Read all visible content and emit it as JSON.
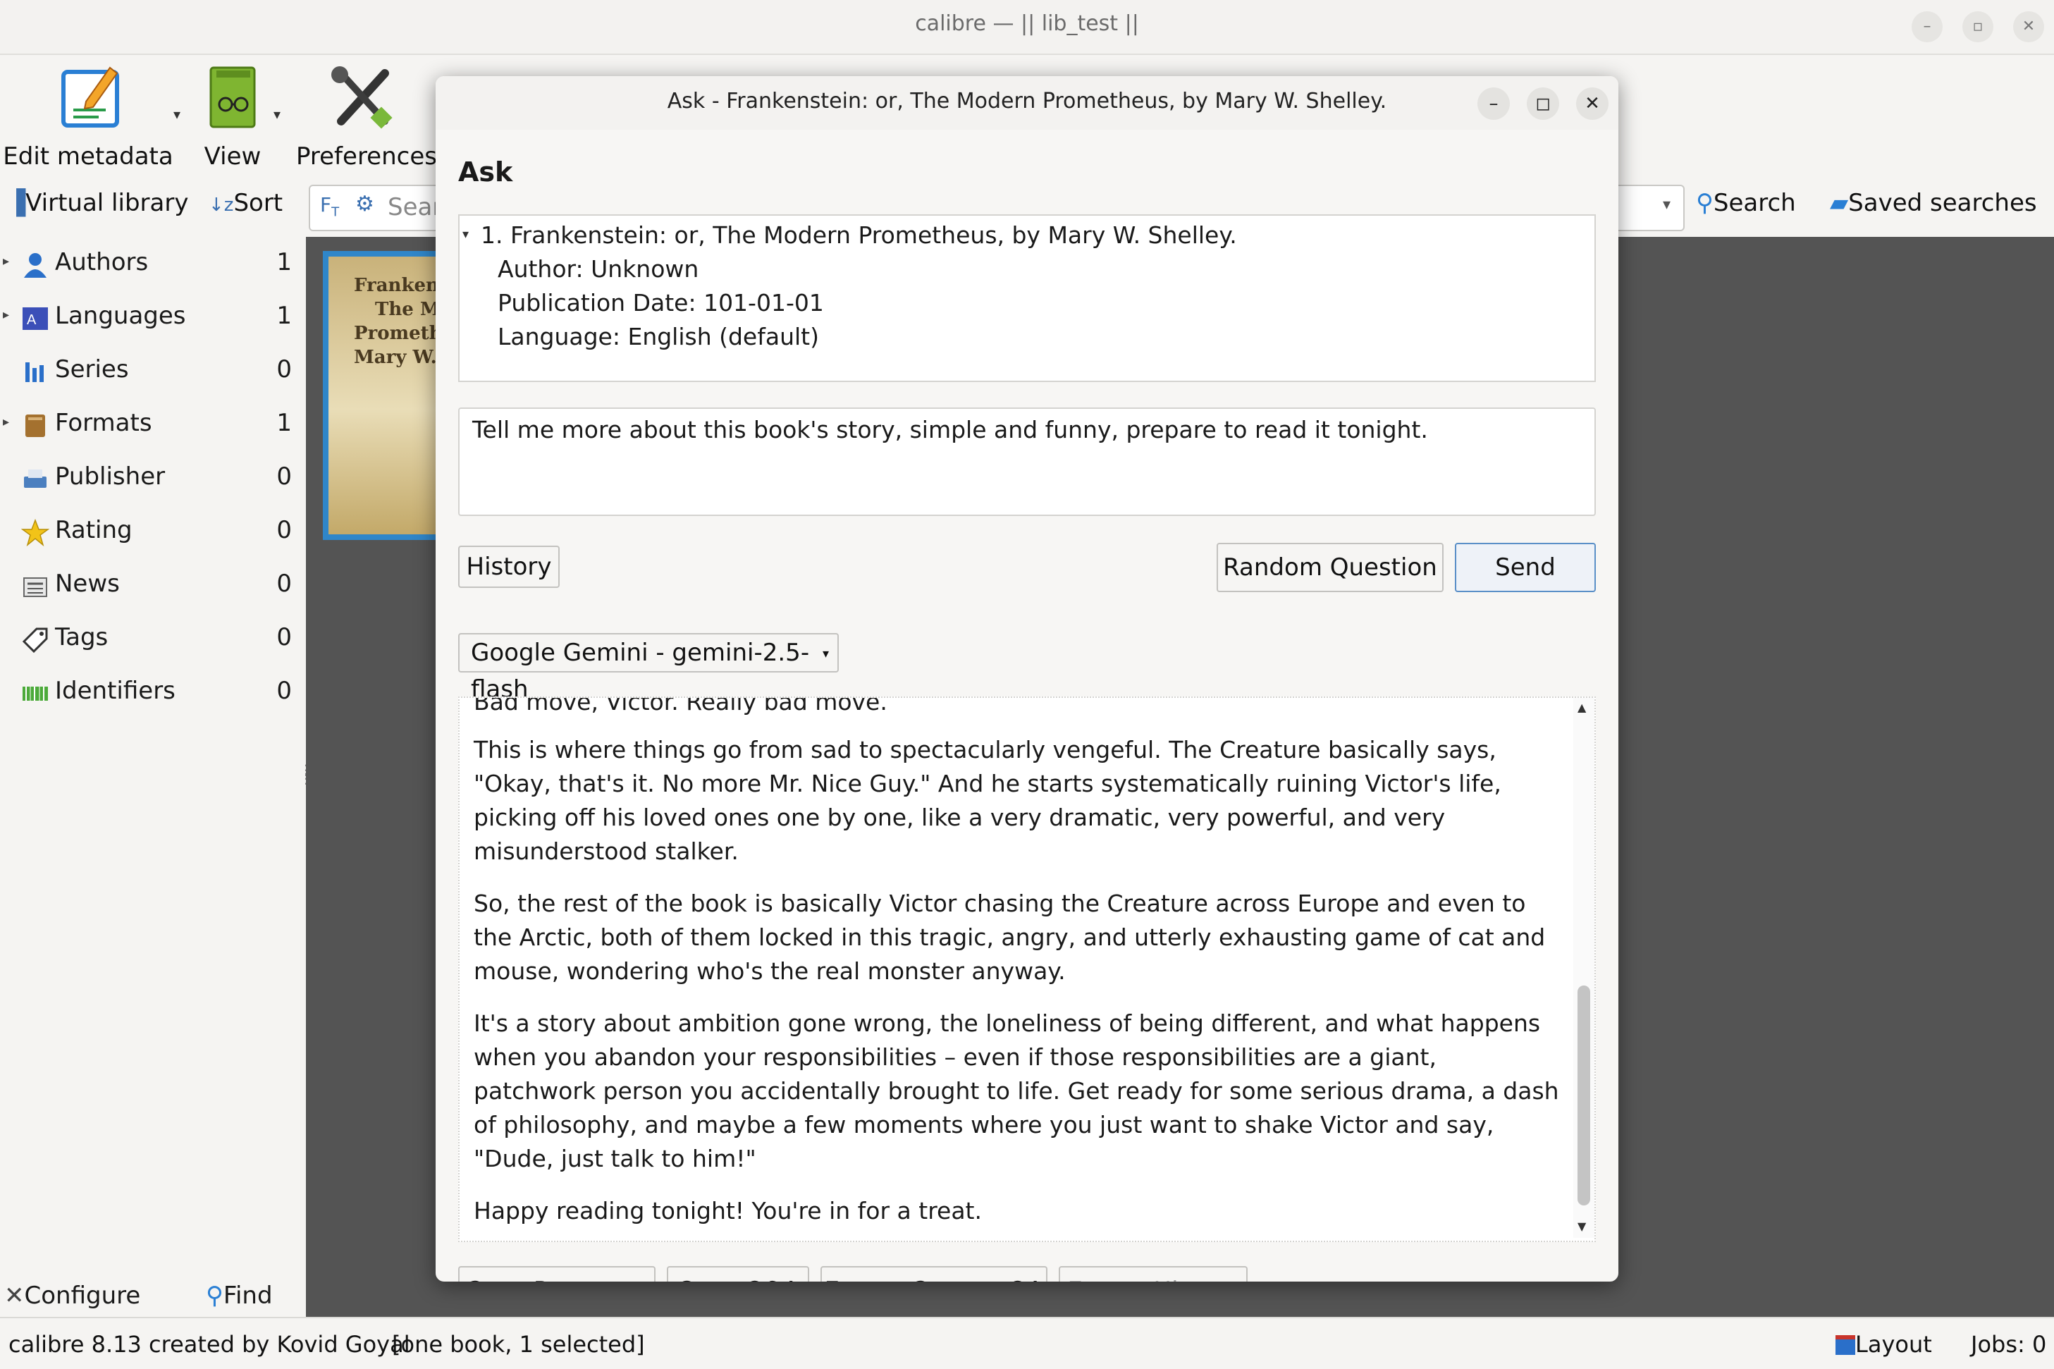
{
  "window": {
    "title": "calibre — || lib_test ||"
  },
  "toolbar": {
    "edit_metadata": "Edit metadata",
    "view": "View",
    "preferences": "Preferences"
  },
  "row2": {
    "virtual_library": "Virtual library",
    "sort": "Sort",
    "search_placeholder": "Sear",
    "search": "Search",
    "saved_searches": "Saved searches"
  },
  "tags": [
    {
      "name": "Authors",
      "count": "1",
      "icon": "person-icon",
      "expandable": true
    },
    {
      "name": "Languages",
      "count": "1",
      "icon": "language-icon",
      "expandable": true
    },
    {
      "name": "Series",
      "count": "0",
      "icon": "series-icon",
      "expandable": false
    },
    {
      "name": "Formats",
      "count": "1",
      "icon": "book-icon",
      "expandable": true
    },
    {
      "name": "Publisher",
      "count": "0",
      "icon": "publisher-icon",
      "expandable": false
    },
    {
      "name": "Rating",
      "count": "0",
      "icon": "star-icon",
      "expandable": false
    },
    {
      "name": "News",
      "count": "0",
      "icon": "news-icon",
      "expandable": false
    },
    {
      "name": "Tags",
      "count": "0",
      "icon": "tag-icon",
      "expandable": false
    },
    {
      "name": "Identifiers",
      "count": "0",
      "icon": "barcode-icon",
      "expandable": false
    }
  ],
  "cover": {
    "lines": [
      "Frankens",
      "The M",
      "Prometh",
      "Mary W."
    ]
  },
  "bottom_left": {
    "configure": "Configure",
    "find": "Find"
  },
  "status": {
    "left": "calibre 8.13 created by Kovid Goyal",
    "selection": "[one book, 1 selected]",
    "layout": "Layout",
    "jobs": "Jobs: 0"
  },
  "dialog": {
    "title": "Ask - Frankenstein: or, The Modern Prometheus, by Mary W. Shelley.",
    "heading": "Ask",
    "book_info": {
      "title_line": "1. Frankenstein: or, The Modern Prometheus, by Mary W. Shelley.",
      "author": "Author: Unknown",
      "date": "Publication Date: 101-01-01",
      "language": "Language: English (default)"
    },
    "question": "Tell me more about this book's story, simple and funny, prepare to read it tonight.",
    "buttons": {
      "history": "History",
      "random": "Random Question",
      "send": "Send",
      "copy_response": "Copy Response",
      "copy_qa": "Copy Q&A",
      "export_current": "Export Current QA",
      "export_history": "Export History"
    },
    "model": "Google Gemini - gemini-2.5-flash",
    "response": {
      "cut_line": "Bad move, Victor. Really bad move.",
      "p1": "This is where things go from sad to spectacularly vengeful. The Creature basically says, \"Okay, that's it. No more Mr. Nice Guy.\" And he starts systematically ruining Victor's life, picking off his loved ones one by one, like a very dramatic, very powerful, and very misunderstood stalker.",
      "p2": "So, the rest of the book is basically Victor chasing the Creature across Europe and even to the Arctic, both of them locked in this tragic, angry, and utterly exhausting game of cat and mouse, wondering who's the real monster anyway.",
      "p3": "It's a story about ambition gone wrong, the loneliness of being different, and what happens when you abandon your responsibilities – even if those responsibilities are a giant, patchwork person you accidentally brought to life. Get ready for some serious drama, a dash of philosophy, and maybe a few moments where you just want to shake Victor and say, \"Dude, just talk to him!\"",
      "p4": "Happy reading tonight! You're in for a treat."
    }
  }
}
